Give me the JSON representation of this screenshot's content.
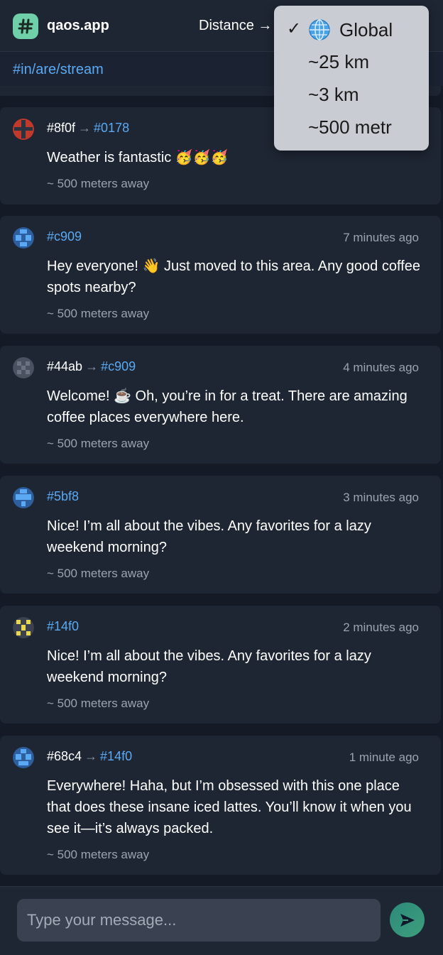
{
  "header": {
    "app_title": "qaos.app",
    "distance_label": "Distance →"
  },
  "channel": "#in/are/stream",
  "dropdown": {
    "selected": "Global",
    "options": [
      "Global",
      "~25 km",
      "~3 km",
      "~500 metr"
    ]
  },
  "messages": [
    {
      "from": "#8f0f",
      "to": "#0178",
      "time": "",
      "text": "Weather is fantastic 🥳🥳🥳",
      "distance": "~ 500 meters away"
    },
    {
      "from": "#c909",
      "to": "",
      "time": "7 minutes ago",
      "text": "Hey everyone! 👋 Just moved to this area. Any good coffee spots nearby?",
      "distance": "~ 500 meters away"
    },
    {
      "from": "#44ab",
      "to": "#c909",
      "time": "4 minutes ago",
      "text": "Welcome! ☕ Oh, you’re in for a treat. There are amazing coffee places everywhere here.",
      "distance": "~ 500 meters away"
    },
    {
      "from": "#5bf8",
      "to": "",
      "time": "3 minutes ago",
      "text": "Nice! I’m all about the vibes. Any favorites for a lazy weekend morning?",
      "distance": "~ 500 meters away"
    },
    {
      "from": "#14f0",
      "to": "",
      "time": "2 minutes ago",
      "text": "Nice! I’m all about the vibes. Any favorites for a lazy weekend morning?",
      "distance": "~ 500 meters away"
    },
    {
      "from": "#68c4",
      "to": "#14f0",
      "time": "1 minute ago",
      "text": "Everywhere! Haha, but I’m obsessed with this one place that does these insane iced lattes. You’ll know it when you see it—it’s always packed.",
      "distance": "~ 500 meters away"
    }
  ],
  "composer": {
    "placeholder": "Type your message..."
  },
  "colors": {
    "accent_link": "#5aa9f2",
    "logo_bg": "#6fcfa8",
    "card_bg": "#1e2633"
  },
  "icons": {
    "logo": "hash-logo-icon",
    "send": "send-icon",
    "globe": "globe-icon",
    "check": "checkmark-icon"
  }
}
